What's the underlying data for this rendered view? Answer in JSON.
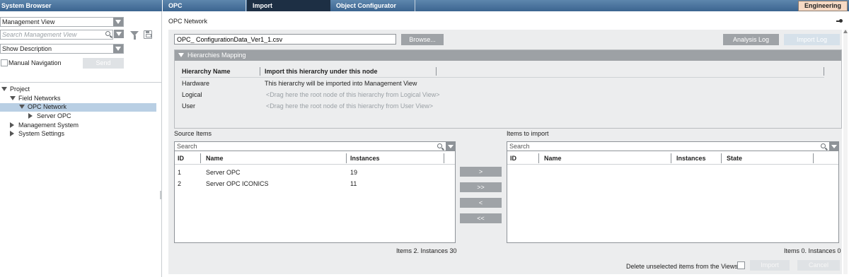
{
  "system_browser": {
    "title": "System Browser",
    "view_select": "Management View",
    "search_placeholder": "Search Management View",
    "description_select": "Show Description",
    "manual_navigation_label": "Manual Navigation",
    "send_label": "Send",
    "tree": {
      "project": "Project",
      "field_networks": "Field Networks",
      "opc_network": "OPC Network",
      "server_opc": "Server OPC",
      "management_system": "Management System",
      "system_settings": "System Settings"
    }
  },
  "tabs": [
    "OPC",
    "Import",
    "Object Configurator"
  ],
  "engineering_label": "Engineering",
  "main": {
    "title": "OPC Network",
    "file_name": "OPC_ ConfigurationData_Ver1_1.csv",
    "browse_label": "Browse...",
    "analysis_log_label": "Analysis Log",
    "import_log_label": "Import Log"
  },
  "hierarchies": {
    "header": "Hierarchies Mapping",
    "col_name": "Hierarchy Name",
    "col_node": "Import this hierarchy under this node",
    "rows": [
      {
        "name": "Hardware",
        "node": "This hierarchy will be imported into Management View"
      },
      {
        "name": "Logical",
        "node": "<Drag here the root node of this hierarchy from Logical View>"
      },
      {
        "name": "User",
        "node": "<Drag here the root node of this hierarchy from User View>"
      }
    ]
  },
  "source": {
    "title": "Source Items",
    "search_placeholder": "Search",
    "columns": [
      "ID",
      "Name",
      "Instances"
    ],
    "rows": [
      {
        "id": "1",
        "name": "Server OPC",
        "instances": "19"
      },
      {
        "id": "2",
        "name": "Server OPC ICONICS",
        "instances": "11"
      }
    ],
    "summary": "Items 2. Instances 30"
  },
  "move_buttons": [
    ">",
    ">>",
    "<",
    "<<"
  ],
  "target": {
    "title": "Items to import",
    "search_placeholder": "Search",
    "columns": [
      "ID",
      "Name",
      "Instances",
      "State"
    ],
    "summary": "Items 0. Instances 0"
  },
  "footer": {
    "delete_label": "Delete unselected items from the Views",
    "import_label": "Import",
    "cancel_label": "Cancel"
  }
}
